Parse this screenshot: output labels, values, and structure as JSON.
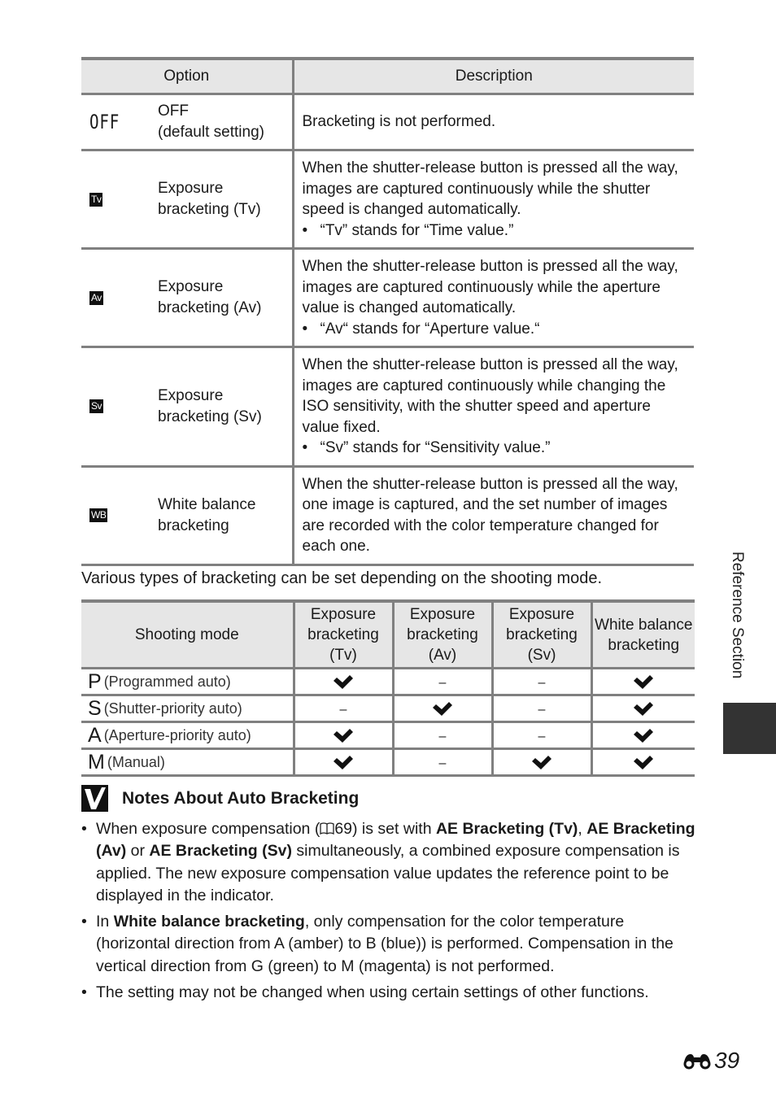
{
  "option_table": {
    "headers": {
      "option": "Option",
      "description": "Description"
    },
    "rows": [
      {
        "icon": "off-icon",
        "icon_text": "OFF",
        "label_lines": [
          "OFF",
          "(default setting)"
        ],
        "description": "Bracketing is not performed.",
        "note": ""
      },
      {
        "icon": "tv-icon",
        "icon_text": "Tv",
        "label_lines": [
          "Exposure",
          "bracketing (Tv)"
        ],
        "description": "When the shutter-release button is pressed all the way, images are captured continuously while the shutter speed is changed automatically.",
        "note": "“Tv” stands for “Time value.”"
      },
      {
        "icon": "av-icon",
        "icon_text": "Av",
        "label_lines": [
          "Exposure",
          "bracketing (Av)"
        ],
        "description": "When the shutter-release button is pressed all the way, images are captured continuously while the aperture value is changed automatically.",
        "note": "“Av“ stands for “Aperture value.“"
      },
      {
        "icon": "sv-icon",
        "icon_text": "Sv",
        "label_lines": [
          "Exposure",
          "bracketing (Sv)"
        ],
        "description": "When the shutter-release button is pressed all the way, images are captured continuously while changing the ISO sensitivity, with the shutter speed and aperture value fixed.",
        "note": "“Sv” stands for “Sensitivity value.”"
      },
      {
        "icon": "wb-icon",
        "icon_text": "WB",
        "label_lines": [
          "White balance",
          "bracketing"
        ],
        "description": "When the shutter-release button is pressed all the way, one image is captured, and the set number of images are recorded with the color temperature changed for each one.",
        "note": ""
      }
    ]
  },
  "intro_text": "Various types of bracketing can be set depending on the shooting mode.",
  "mode_table": {
    "headers": [
      "Shooting mode",
      "Exposure bracketing (Tv)",
      "Exposure bracketing (Av)",
      "Exposure bracketing (Sv)",
      "White balance bracketing"
    ],
    "rows": [
      {
        "letter": "P",
        "name": "(Programmed auto)",
        "values": [
          "check",
          "dash",
          "dash",
          "check"
        ]
      },
      {
        "letter": "S",
        "name": "(Shutter-priority auto)",
        "values": [
          "dash",
          "check",
          "dash",
          "check"
        ]
      },
      {
        "letter": "A",
        "name": "(Aperture-priority auto)",
        "values": [
          "check",
          "dash",
          "dash",
          "check"
        ]
      },
      {
        "letter": "M",
        "name": "(Manual)",
        "values": [
          "check",
          "dash",
          "check",
          "check"
        ]
      }
    ],
    "dash_symbol": "–"
  },
  "notes": {
    "title": "Notes About Auto Bracketing",
    "bullet_symbol": "•",
    "items": [
      {
        "parts": [
          {
            "t": "When exposure compensation ("
          },
          {
            "icon": "book-icon"
          },
          {
            "t": "69) is set with "
          },
          {
            "b": "AE Bracketing (Tv)"
          },
          {
            "t": ", "
          },
          {
            "b": "AE Bracketing (Av)"
          },
          {
            "t": " or "
          },
          {
            "b": "AE Bracketing (Sv)"
          },
          {
            "t": " simultaneously, a combined exposure compensation is applied. The new exposure compensation value updates the reference point to be displayed in the indicator."
          }
        ]
      },
      {
        "parts": [
          {
            "t": "In "
          },
          {
            "b": "White balance bracketing"
          },
          {
            "t": ", only compensation for the color temperature (horizontal direction from A (amber) to B (blue)) is performed. Compensation in the vertical direction from G (green) to M (magenta) is not performed."
          }
        ]
      },
      {
        "parts": [
          {
            "t": "The setting may not be changed when using certain settings of other functions."
          }
        ]
      }
    ]
  },
  "side_tab": {
    "label": "Reference Section"
  },
  "page_number": "39"
}
